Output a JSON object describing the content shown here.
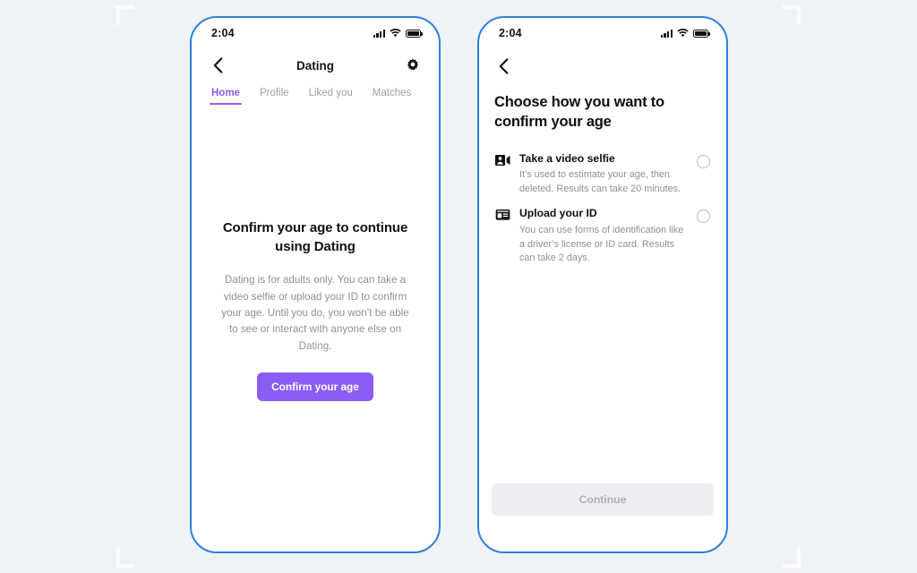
{
  "theme": {
    "background": "#eff2f6",
    "phone_border": "#2f7fe0",
    "accent_purple": "#8b5cf6",
    "muted_text": "#8c9196",
    "disabled_button_bg": "#eceef1"
  },
  "phone_left": {
    "status_bar": {
      "time": "2:04",
      "signal_icon": "cellular-signal-icon",
      "wifi_icon": "wifi-icon",
      "battery_icon": "battery-icon"
    },
    "nav": {
      "back_icon": "back-chevron-icon",
      "title": "Dating",
      "settings_icon": "gear-icon"
    },
    "tabs": [
      {
        "label": "Home",
        "active": true
      },
      {
        "label": "Profile",
        "active": false
      },
      {
        "label": "Liked you",
        "active": false
      },
      {
        "label": "Matches",
        "active": false
      }
    ],
    "content": {
      "headline": "Confirm your age to continue using Dating",
      "paragraph": "Dating is for adults only. You can take a video selfie or upload your ID to confirm your age. Until you do, you won’t be able to see or interact with anyone else on Dating.",
      "cta_label": "Confirm your age"
    }
  },
  "phone_right": {
    "status_bar": {
      "time": "2:04",
      "signal_icon": "cellular-signal-icon",
      "wifi_icon": "wifi-icon",
      "battery_icon": "battery-icon"
    },
    "nav": {
      "back_icon": "back-chevron-icon"
    },
    "title": "Choose how you want to confirm your age",
    "options": [
      {
        "icon": "video-selfie-icon",
        "title": "Take a video selfie",
        "description": "It’s used to estimate your age, then deleted. Results can take 20 minutes.",
        "selected": false
      },
      {
        "icon": "id-card-icon",
        "title": "Upload your ID",
        "description": "You can use forms of identification like a driver’s license or ID card. Results can take 2 days.",
        "selected": false
      }
    ],
    "continue_label": "Continue"
  }
}
